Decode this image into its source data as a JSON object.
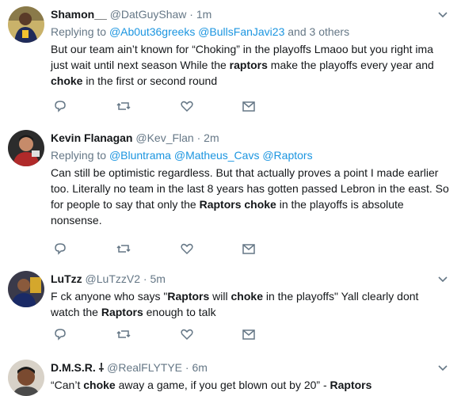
{
  "tweets": [
    {
      "name": "Shamon__",
      "handle": "@DatGuyShaw",
      "time": "1m",
      "reply_prefix": "Replying to ",
      "reply_links": [
        "@Ab0ut36greeks",
        "@BullsFanJavi23"
      ],
      "reply_suffix": " and 3 others",
      "text": [
        {
          "t": "But our team ain’t known for “Choking” in the playoffs Lmaoo but you right ima just wait until next season While the "
        },
        {
          "t": "raptors",
          "b": true
        },
        {
          "t": " make the playoffs every year and "
        },
        {
          "t": "choke",
          "b": true
        },
        {
          "t": " in the first or second round"
        }
      ]
    },
    {
      "name": "Kevin Flanagan",
      "handle": "@Kev_Flan",
      "time": "2m",
      "reply_prefix": "Replying to ",
      "reply_links": [
        "@Bluntrama",
        "@Matheus_Cavs",
        "@Raptors"
      ],
      "reply_suffix": "",
      "text": [
        {
          "t": "Can still be optimistic regardless. But that actually proves a point I made earlier too. Literally no team in the last 8 years has gotten passed Lebron in the east. So for people to say that only the "
        },
        {
          "t": "Raptors choke",
          "b": true
        },
        {
          "t": " in the playoffs is absolute nonsense."
        }
      ]
    },
    {
      "name": "LuTzz",
      "handle": "@LuTzzV2",
      "time": "5m",
      "text": [
        {
          "t": "F  ck anyone who says \""
        },
        {
          "t": "Raptors",
          "b": true
        },
        {
          "t": " will "
        },
        {
          "t": "choke",
          "b": true
        },
        {
          "t": " in the playoffs\" Yall clearly dont watch the "
        },
        {
          "t": "Raptors",
          "b": true
        },
        {
          "t": " enough to talk"
        }
      ]
    },
    {
      "name": "D.M.S.R. ⸸",
      "handle": "@RealFLYTYE",
      "time": "6m",
      "text": [
        {
          "t": "“Can’t "
        },
        {
          "t": "choke",
          "b": true
        },
        {
          "t": " away a game, if you get blown out by 20” - "
        },
        {
          "t": "Raptors",
          "b": true
        }
      ]
    }
  ],
  "separator": " · ",
  "icons": [
    "reply-icon",
    "retweet-icon",
    "like-icon",
    "direct-message-icon",
    "caret-down-icon"
  ],
  "colors": {
    "link": "#1b95e0",
    "muted": "#657786",
    "text": "#14171a",
    "border": "#e6ecf0"
  }
}
